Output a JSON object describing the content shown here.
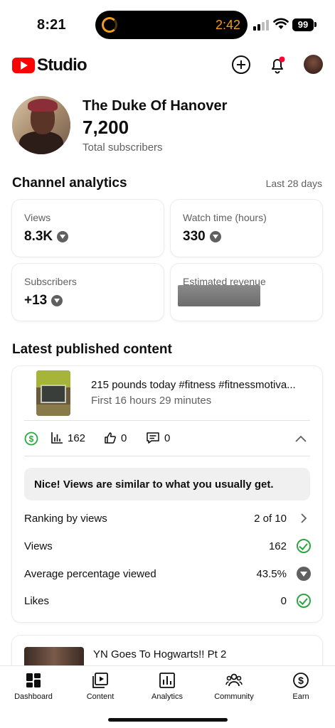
{
  "status_bar": {
    "time": "8:21",
    "timer": "2:42",
    "battery": "99"
  },
  "header": {
    "app_name": "Studio",
    "create_icon": "add-circle-icon",
    "notification_icon": "bell-icon",
    "brand_color": "#ff0000"
  },
  "channel": {
    "name": "The Duke Of Hanover",
    "subscribers": "7,200",
    "subscribers_label": "Total subscribers"
  },
  "analytics": {
    "title": "Channel analytics",
    "range": "Last 28 days",
    "metrics": [
      {
        "label": "Views",
        "value": "8.3K",
        "trend": "down"
      },
      {
        "label": "Watch time (hours)",
        "value": "330",
        "trend": "down"
      },
      {
        "label": "Subscribers",
        "value": "+13",
        "trend": "down"
      },
      {
        "label": "Estimated revenue",
        "value": "",
        "redacted": true
      }
    ]
  },
  "latest": {
    "title": "Latest published content",
    "video": {
      "title": "215 pounds today  #fitness #fitnessmotiva...",
      "subtitle": "First 16 hours 29 minutes",
      "views": "162",
      "likes": "0",
      "comments": "0",
      "callout": "Nice! Views are similar to what you usually get.",
      "rows": [
        {
          "label": "Ranking by views",
          "value": "2 of 10",
          "icon": "chevron-right-icon"
        },
        {
          "label": "Views",
          "value": "162",
          "icon": "check-circle-icon"
        },
        {
          "label": "Average percentage viewed",
          "value": "43.5%",
          "icon": "down-arrow-icon"
        },
        {
          "label": "Likes",
          "value": "0",
          "icon": "check-circle-icon"
        }
      ]
    },
    "video2": {
      "title": "YN Goes To Hogwarts!! Pt 2"
    }
  },
  "nav": [
    {
      "label": "Dashboard",
      "icon": "dashboard-icon"
    },
    {
      "label": "Content",
      "icon": "content-icon"
    },
    {
      "label": "Analytics",
      "icon": "analytics-icon"
    },
    {
      "label": "Community",
      "icon": "community-icon"
    },
    {
      "label": "Earn",
      "icon": "earn-icon"
    }
  ]
}
